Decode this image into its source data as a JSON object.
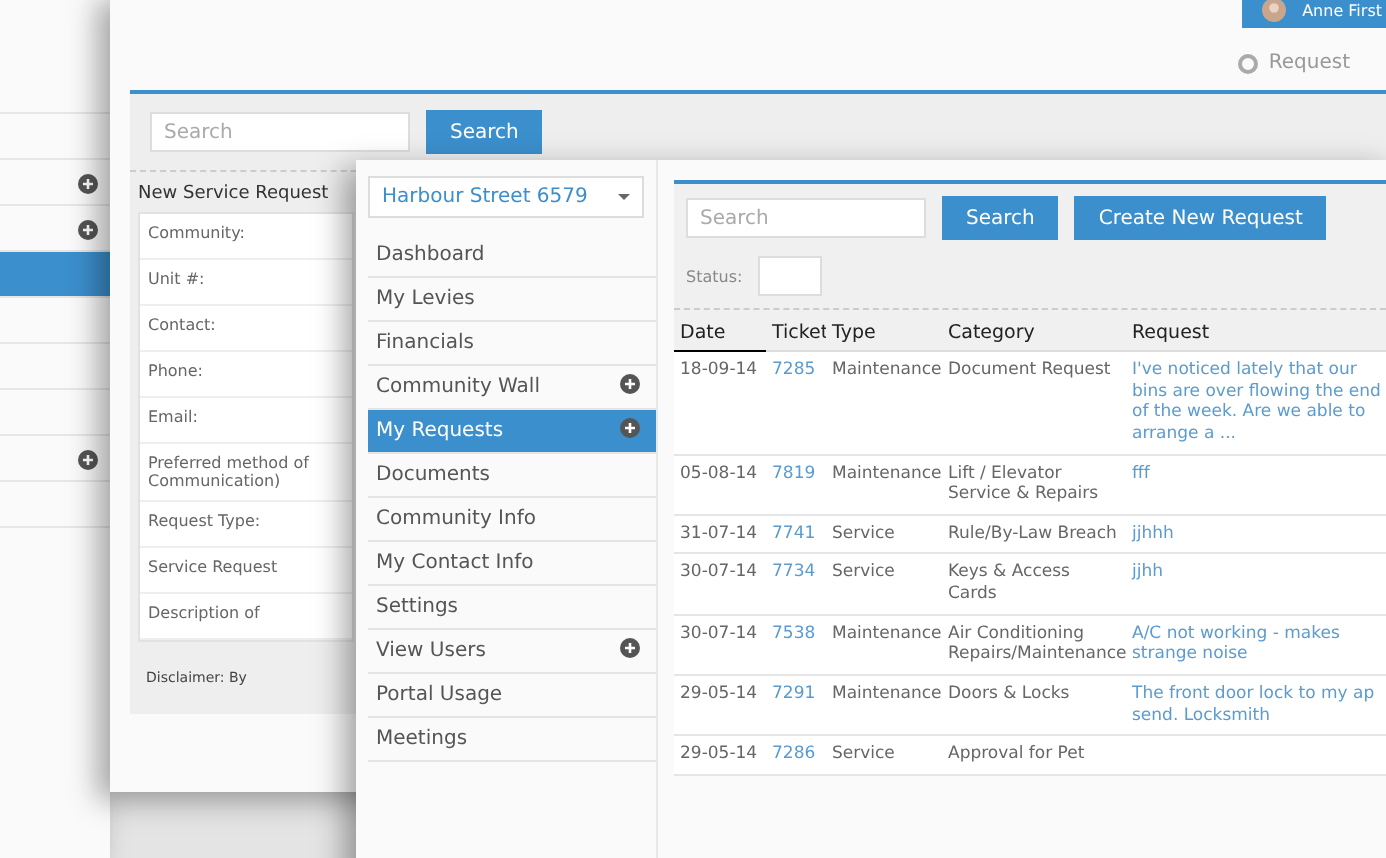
{
  "back_sidebar": {
    "items": [
      {
        "selected": false,
        "expandable": false
      },
      {
        "selected": false,
        "expandable": false
      },
      {
        "selected": false,
        "expandable": true
      },
      {
        "selected": false,
        "expandable": true
      },
      {
        "selected": true,
        "expandable": false
      },
      {
        "selected": false,
        "expandable": false
      },
      {
        "selected": false,
        "expandable": false
      },
      {
        "selected": false,
        "expandable": false
      },
      {
        "selected": false,
        "expandable": true
      },
      {
        "selected": false,
        "expandable": false
      }
    ]
  },
  "back_window": {
    "user": {
      "name": "Anne First"
    },
    "request_link": "Request",
    "search": {
      "placeholder": "Search",
      "button": "Search"
    },
    "form": {
      "title": "New Service Request",
      "fields": [
        "Community:",
        "Unit #:",
        "Contact:",
        "Phone:",
        "Email:",
        "Preferred method of Communication)",
        "Request Type:",
        "Service Request",
        "Description of"
      ],
      "disclaimer": "Disclaimer: By"
    }
  },
  "front_window": {
    "community": "Harbour Street 6579",
    "nav": [
      {
        "label": "Dashboard",
        "selected": false,
        "expandable": false
      },
      {
        "label": "My Levies",
        "selected": false,
        "expandable": false
      },
      {
        "label": "Financials",
        "selected": false,
        "expandable": false
      },
      {
        "label": "Community Wall",
        "selected": false,
        "expandable": true
      },
      {
        "label": "My Requests",
        "selected": true,
        "expandable": true
      },
      {
        "label": "Documents",
        "selected": false,
        "expandable": false
      },
      {
        "label": "Community Info",
        "selected": false,
        "expandable": false
      },
      {
        "label": "My Contact Info",
        "selected": false,
        "expandable": false
      },
      {
        "label": "Settings",
        "selected": false,
        "expandable": false
      },
      {
        "label": "View Users",
        "selected": false,
        "expandable": true
      },
      {
        "label": "Portal Usage",
        "selected": false,
        "expandable": false
      },
      {
        "label": "Meetings",
        "selected": false,
        "expandable": false
      }
    ],
    "search": {
      "placeholder": "Search",
      "button": "Search"
    },
    "create_button": "Create New Request",
    "status_label": "Status:",
    "table": {
      "columns": [
        {
          "label": "Date",
          "sorted": true
        },
        {
          "label": "Ticket",
          "sorted": false
        },
        {
          "label": "Type",
          "sorted": false
        },
        {
          "label": "Category",
          "sorted": false
        },
        {
          "label": "Request",
          "sorted": false
        }
      ],
      "rows": [
        [
          "18-09-14",
          "7285",
          "Maintenance",
          "Document Request",
          "I've noticed lately that our bins are over flowing the end of the week. Are we able to arrange a ..."
        ],
        [
          "05-08-14",
          "7819",
          "Maintenance",
          "Lift / Elevator Service & Repairs",
          "fff"
        ],
        [
          "31-07-14",
          "7741",
          "Service",
          "Rule/By-Law Breach",
          "jjhhh"
        ],
        [
          "30-07-14",
          "7734",
          "Service",
          "Keys & Access Cards",
          "jjhh"
        ],
        [
          "30-07-14",
          "7538",
          "Maintenance",
          "Air Conditioning Repairs/Maintenance",
          "A/C not working - makes strange noise"
        ],
        [
          "29-05-14",
          "7291",
          "Maintenance",
          "Doors & Locks",
          "The front door lock to my ap send. Locksmith"
        ],
        [
          "29-05-14",
          "7286",
          "Service",
          "Approval for Pet",
          ""
        ]
      ]
    }
  }
}
